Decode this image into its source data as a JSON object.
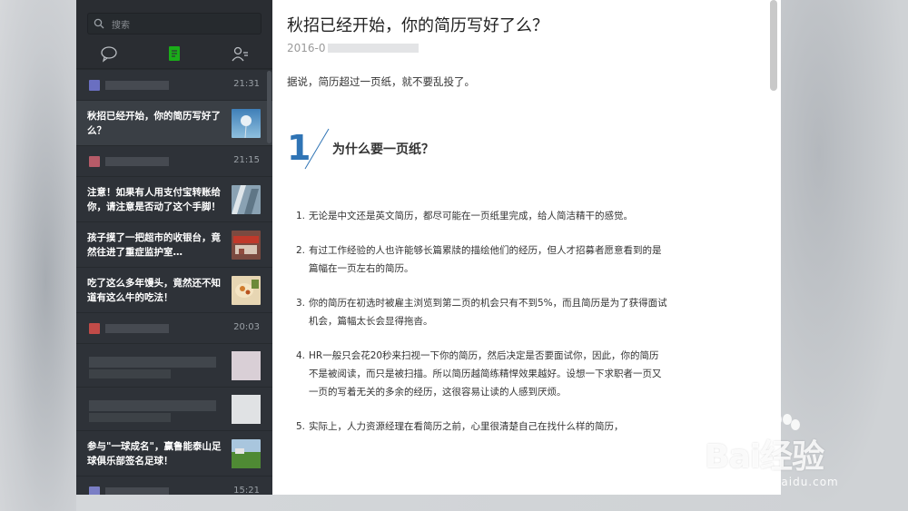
{
  "search": {
    "placeholder": "搜索"
  },
  "nav": {
    "items": [
      "chat-icon",
      "article-icon",
      "contacts-icon"
    ],
    "active_color": "#1aad19"
  },
  "feed": [
    {
      "type": "sender",
      "avatar_color": "#6a6fc1",
      "time": "21:31"
    },
    {
      "type": "article",
      "title": "秋招已经开始，你的简历写好了么？",
      "selected": true,
      "thumb": "dandelion"
    },
    {
      "type": "sender",
      "avatar_color": "#b65b68",
      "time": "21:15"
    },
    {
      "type": "article",
      "title": "注意！如果有人用支付宝转账给你，请注意是否动了这个手脚！",
      "thumb": "building"
    },
    {
      "type": "article",
      "title": "孩子摸了一把超市的收银台，竟然往进了重症监护室…",
      "thumb": "supermarket"
    },
    {
      "type": "article",
      "title": "吃了这么多年馒头，竟然还不知道有这么牛的吃法！",
      "thumb": "food"
    },
    {
      "type": "sender",
      "avatar_color": "#c14b48",
      "time": "20:03"
    },
    {
      "type": "blurred"
    },
    {
      "type": "blurred"
    },
    {
      "type": "article",
      "title": "参与\"一球成名\"，赢鲁能泰山足球俱乐部签名足球！",
      "thumb": "field"
    },
    {
      "type": "sender",
      "avatar_color": "#7a7ec5",
      "time": "15:21"
    }
  ],
  "article": {
    "title": "秋招已经开始，你的简历写好了么？",
    "date_prefix": "2016-0",
    "lead": "据说，简历超过一页纸，就不要乱投了。",
    "section_number": "1",
    "section_title": "为什么要一页纸？",
    "items": [
      {
        "num": "1.",
        "text": "无论是中文还是英文简历，都尽可能在一页纸里完成，给人简洁精干的感觉。"
      },
      {
        "num": "2.",
        "text": "有过工作经验的人也许能够长篇累牍的描绘他们的经历，但人才招募者愿意看到的是篇幅在一页左右的简历。"
      },
      {
        "num": "3.",
        "text": "你的简历在初选时被雇主浏览到第二页的机会只有不到5%，而且简历是为了获得面试机会，篇幅太长会显得拖沓。"
      },
      {
        "num": "4.",
        "text": "HR一般只会花20秒来扫视一下你的简历，然后决定是否要面试你，因此，你的简历不是被阅读，而只是被扫描。所以简历越简练精悍效果越好。设想一下求职者一页又一页的写着无关的多余的经历，这很容易让读的人感到厌烦。"
      },
      {
        "num": "5.",
        "text": "实际上，人力资源经理在看简历之前，心里很清楚自己在找什么样的简历，"
      }
    ],
    "accent_color": "#2f74b5"
  },
  "watermark": {
    "main": "Bai经验",
    "sub": "jingyan.baidu.com"
  }
}
